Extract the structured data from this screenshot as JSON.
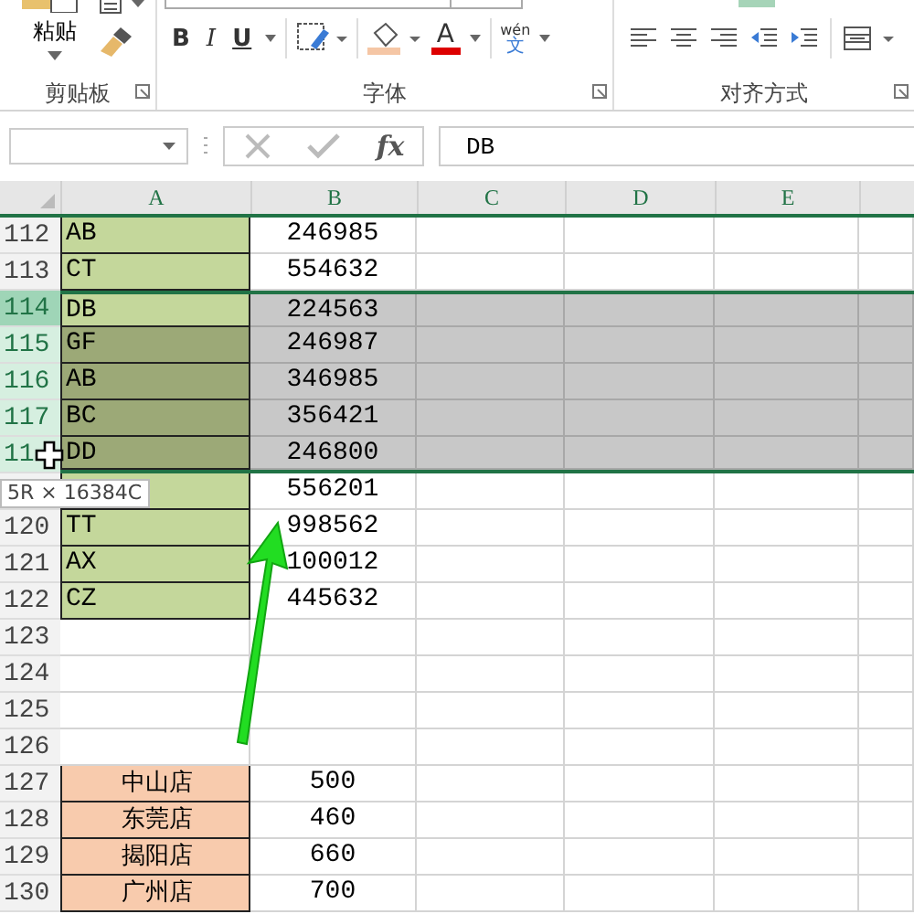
{
  "ribbon": {
    "groups": [
      {
        "kind": "clipboard",
        "label": "剪贴板",
        "paste_label": "粘贴"
      },
      {
        "kind": "font",
        "label": "字体",
        "buttons": [
          "B",
          "I",
          "U"
        ],
        "font_color_label": "A",
        "phonetic": "wén",
        "phonetic_char": "文"
      },
      {
        "kind": "align",
        "label": "对齐方式"
      }
    ]
  },
  "formula_bar": {
    "fx": "fx",
    "value": "DB"
  },
  "columns": [
    {
      "label": "A"
    },
    {
      "label": "B"
    },
    {
      "label": "C"
    },
    {
      "label": "D"
    },
    {
      "label": "E"
    }
  ],
  "rows": [
    {
      "num": "112",
      "kind": "label",
      "a": "AB",
      "b": "246985",
      "selected": false,
      "active": false
    },
    {
      "num": "113",
      "kind": "label",
      "a": "CT",
      "b": "554632",
      "selected": false,
      "active": false
    },
    {
      "num": "114",
      "kind": "label",
      "a": "DB",
      "b": "224563",
      "selected": true,
      "active": true
    },
    {
      "num": "115",
      "kind": "label",
      "a": "GF",
      "b": "246987",
      "selected": true,
      "active": false
    },
    {
      "num": "116",
      "kind": "label",
      "a": "AB",
      "b": "346985",
      "selected": true,
      "active": false
    },
    {
      "num": "117",
      "kind": "label",
      "a": "BC",
      "b": "356421",
      "selected": true,
      "active": false
    },
    {
      "num": "11",
      "kind": "label",
      "a": "DD",
      "b": "246800",
      "selected": true,
      "active": false
    },
    {
      "num": "",
      "kind": "label",
      "a": "",
      "b": "556201",
      "selected": false,
      "active": false
    },
    {
      "num": "120",
      "kind": "label",
      "a": "TT",
      "b": "998562",
      "selected": false,
      "active": false
    },
    {
      "num": "121",
      "kind": "label",
      "a": "AX",
      "b": "100012",
      "selected": false,
      "active": false
    },
    {
      "num": "122",
      "kind": "label",
      "a": "CZ",
      "b": "445632",
      "selected": false,
      "active": false
    },
    {
      "num": "123",
      "kind": "empty",
      "a": "",
      "b": "",
      "selected": false,
      "active": false
    },
    {
      "num": "124",
      "kind": "empty",
      "a": "",
      "b": "",
      "selected": false,
      "active": false
    },
    {
      "num": "125",
      "kind": "empty",
      "a": "",
      "b": "",
      "selected": false,
      "active": false
    },
    {
      "num": "126",
      "kind": "empty",
      "a": "",
      "b": "",
      "selected": false,
      "active": false
    },
    {
      "num": "127",
      "kind": "store",
      "a": "中山店",
      "b": "500",
      "selected": false,
      "active": false
    },
    {
      "num": "128",
      "kind": "store",
      "a": "东莞店",
      "b": "460",
      "selected": false,
      "active": false
    },
    {
      "num": "129",
      "kind": "store",
      "a": "揭阳店",
      "b": "660",
      "selected": false,
      "active": false
    },
    {
      "num": "130",
      "kind": "store",
      "a": "广州店",
      "b": "700",
      "selected": false,
      "active": false
    }
  ],
  "size_tip": "5R × 16384C"
}
